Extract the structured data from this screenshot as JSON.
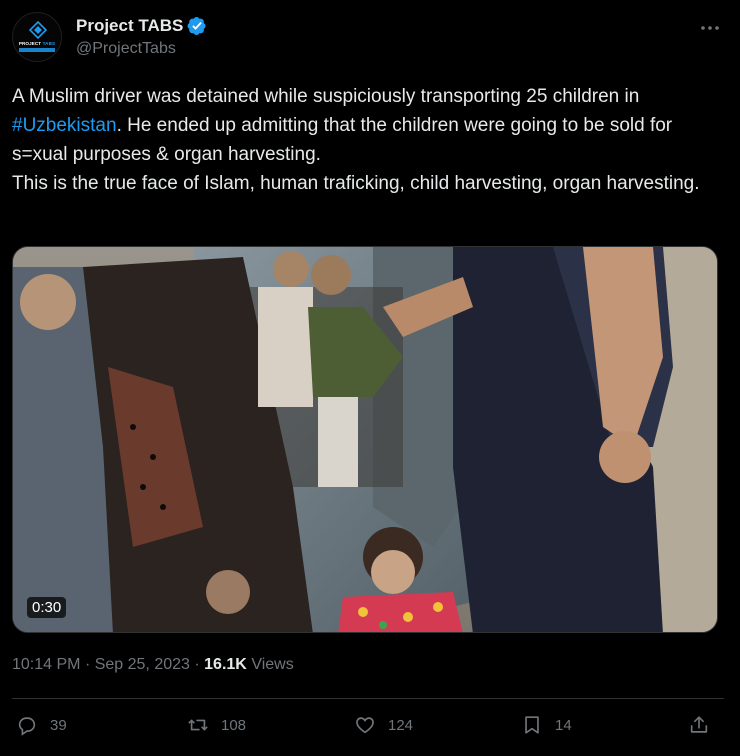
{
  "author": {
    "display_name": "Project TABS",
    "handle": "@ProjectTabs",
    "avatar_logo_text": "PROJECT TABS"
  },
  "tweet": {
    "text_part1": "A Muslim driver was detained while suspiciously transporting 25 children in ",
    "hashtag": "#Uzbekistan",
    "text_part2": ". He ended up admitting that the children were going to be sold for s=xual purposes & organ harvesting.",
    "text_line2": "This is the true face of Islam, human traficking, child harvesting, organ harvesting."
  },
  "media": {
    "video_duration": "0:30"
  },
  "meta": {
    "time": "10:14 PM",
    "separator": "·",
    "date": "Sep 25, 2023",
    "views_count": "16.1K",
    "views_label": "Views"
  },
  "actions": {
    "replies": "39",
    "retweets": "108",
    "likes": "124",
    "bookmarks": "14"
  },
  "icons": {
    "verified": "verified-badge-icon",
    "more": "more-options-icon",
    "reply": "reply-icon",
    "retweet": "retweet-icon",
    "like": "heart-icon",
    "bookmark": "bookmark-icon",
    "share": "share-icon"
  },
  "colors": {
    "accent": "#1d9bf0",
    "text": "#e7e9ea",
    "muted": "#71767b",
    "background": "#000000"
  }
}
